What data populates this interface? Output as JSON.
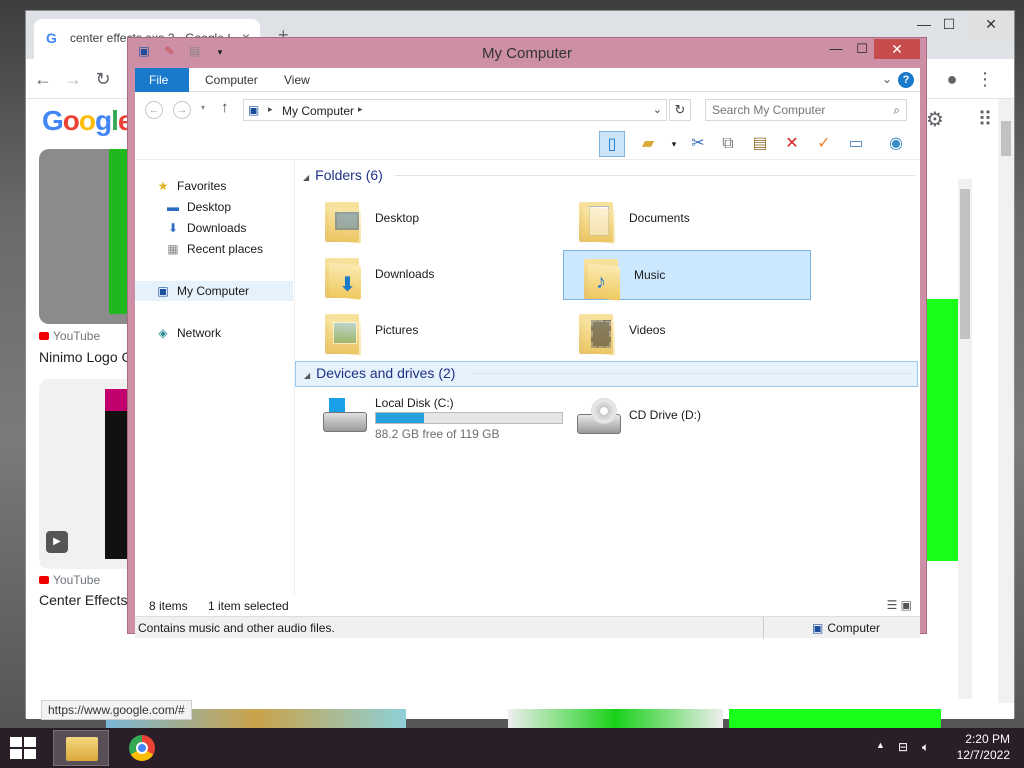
{
  "chrome": {
    "tab_title": "center effects exo 2 - Google Se",
    "new_tab": "+",
    "minimize": "—",
    "maximize": "☐",
    "close": "✕",
    "tab_close": "×",
    "status_url": "https://www.google.com/#",
    "cards": [
      {
        "source": "YouTube",
        "title": "Ninimo Logo C"
      },
      {
        "source": "YouTube",
        "title": "Center Effects"
      }
    ]
  },
  "explorer": {
    "title": "My Computer",
    "tabs": [
      "File",
      "Computer",
      "View"
    ],
    "address": {
      "location": "My Computer"
    },
    "search": {
      "placeholder": "Search My Computer"
    },
    "nav": {
      "favorites_label": "Favorites",
      "favorites": [
        "Desktop",
        "Downloads",
        "Recent places"
      ],
      "my_computer": "My Computer",
      "network": "Network"
    },
    "groups": {
      "folders": "Folders (6)",
      "devices": "Devices and drives (2)"
    },
    "folders": [
      "Desktop",
      "Documents",
      "Downloads",
      "Music",
      "Pictures",
      "Videos"
    ],
    "drives": [
      {
        "name": "Local Disk (C:)",
        "free_text": "88.2 GB free of 119 GB",
        "used_fraction": 0.26
      },
      {
        "name": "CD Drive (D:)"
      }
    ],
    "status": {
      "items": "8 items",
      "selected": "1 item selected"
    },
    "footer": {
      "description": "Contains music and other audio files.",
      "location": "Computer"
    }
  },
  "taskbar": {
    "time": "2:20 PM",
    "date": "12/7/2022"
  },
  "colors": {
    "accent": "#1979ca",
    "window_frame": "#cc8fa5",
    "taskbar": "#2a1f28",
    "selection": "#cce8ff"
  }
}
